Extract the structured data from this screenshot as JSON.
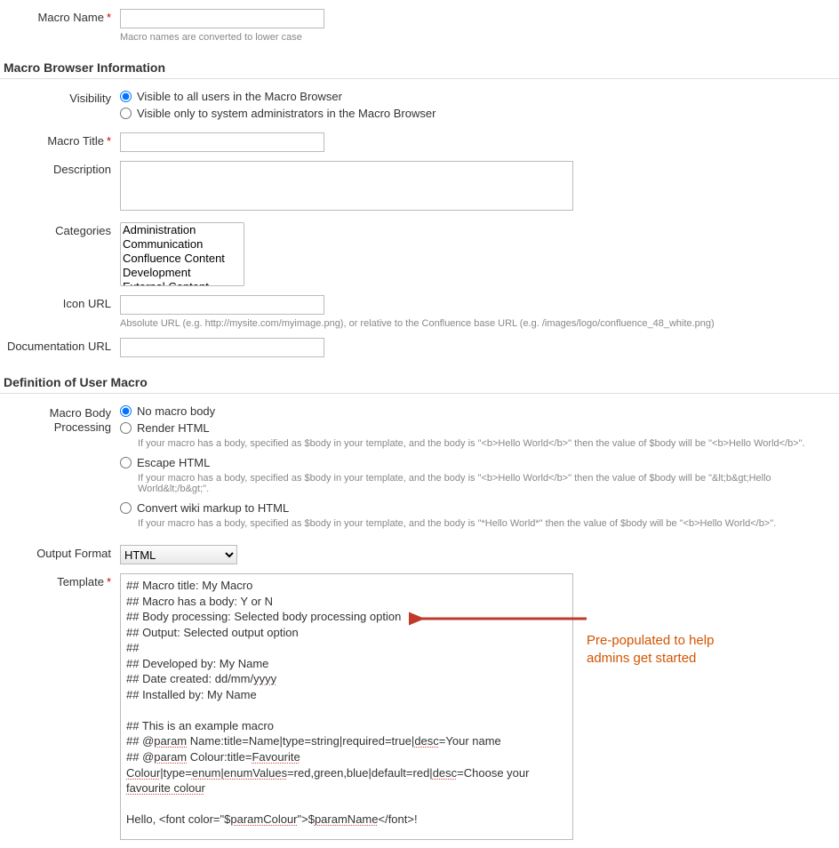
{
  "macroName": {
    "label": "Macro Name",
    "required": true,
    "value": "",
    "hint": "Macro names are converted to lower case"
  },
  "sections": {
    "browserInfo": "Macro Browser Information",
    "definition": "Definition of User Macro"
  },
  "visibility": {
    "label": "Visibility",
    "options": [
      {
        "label": "Visible to all users in the Macro Browser",
        "checked": true
      },
      {
        "label": "Visible only to system administrators in the Macro Browser",
        "checked": false
      }
    ]
  },
  "macroTitle": {
    "label": "Macro Title",
    "required": true,
    "value": ""
  },
  "description": {
    "label": "Description",
    "value": ""
  },
  "categories": {
    "label": "Categories",
    "options": [
      "Administration",
      "Communication",
      "Confluence Content",
      "Development",
      "External Content"
    ]
  },
  "iconUrl": {
    "label": "Icon URL",
    "value": "",
    "hint": "Absolute URL (e.g. http://mysite.com/myimage.png), or relative to the Confluence base URL (e.g. /images/logo/confluence_48_white.png)"
  },
  "docUrl": {
    "label": "Documentation URL",
    "value": ""
  },
  "bodyProcessing": {
    "label": "Macro Body Processing",
    "options": [
      {
        "label": "No macro body",
        "checked": true,
        "hint": ""
      },
      {
        "label": "Render HTML",
        "checked": false,
        "hint": "If your macro has a body, specified as $body in your template, and the body is \"<b>Hello World</b>\" then the value of $body will be \"<b>Hello World</b>\"."
      },
      {
        "label": "Escape HTML",
        "checked": false,
        "hint": "If your macro has a body, specified as $body in your template, and the body is \"<b>Hello World</b>\" then the value of $body will be \"&lt;b&gt;Hello World&lt;/b&gt;\"."
      },
      {
        "label": "Convert wiki markup to HTML",
        "checked": false,
        "hint": "If your macro has a body, specified as $body in your template, and the body is \"*Hello World*\" then the value of $body will be \"<b>Hello World</b>\"."
      }
    ]
  },
  "outputFormat": {
    "label": "Output Format",
    "selected": "HTML",
    "options": [
      "HTML"
    ]
  },
  "template": {
    "label": "Template",
    "required": true,
    "lines": [
      {
        "plain": "## Macro title: My Macro"
      },
      {
        "plain": "## Macro has a body: Y or N"
      },
      {
        "plain": "## Body processing: Selected body processing option"
      },
      {
        "plain": "## Output: Selected output option"
      },
      {
        "plain": "##"
      },
      {
        "plain": "## Developed by: My Name"
      },
      {
        "prefix": "## Date created: dd/mm/",
        "spell": "yyyy",
        "suffix": ""
      },
      {
        "plain": "## Installed by: My Name"
      },
      {
        "blank": true
      },
      {
        "plain": "## This is an example macro"
      },
      {
        "prefix": "## @",
        "spell": "param",
        "suffix": " Name:title=Name|type=string|required=true|",
        "spell2": "desc",
        "suffix2": "=Your name"
      },
      {
        "prefix": "## @",
        "spell": "param",
        "suffix": " Colour:title=",
        "spell2": "Favourite",
        "suffix2": ""
      },
      {
        "prefix": "",
        "spell": "Colour",
        "mid": "|type=",
        "spell2": "enum",
        "mid2": "|",
        "spell3": "enumValues",
        "mid3": "=red,green,blue|default=red|",
        "spell4": "desc",
        "mid4": "=Choose your ",
        "spell5": "favourite colour",
        "suffix": ""
      },
      {
        "blank": true
      },
      {
        "prefix": "Hello, <font color=\"$",
        "spell": "paramColour",
        "mid": "\">$",
        "spell2": "paramName",
        "suffix": "</font>!"
      }
    ]
  },
  "annotation": {
    "line1": "Pre-populated to help",
    "line2": "admins get started"
  }
}
